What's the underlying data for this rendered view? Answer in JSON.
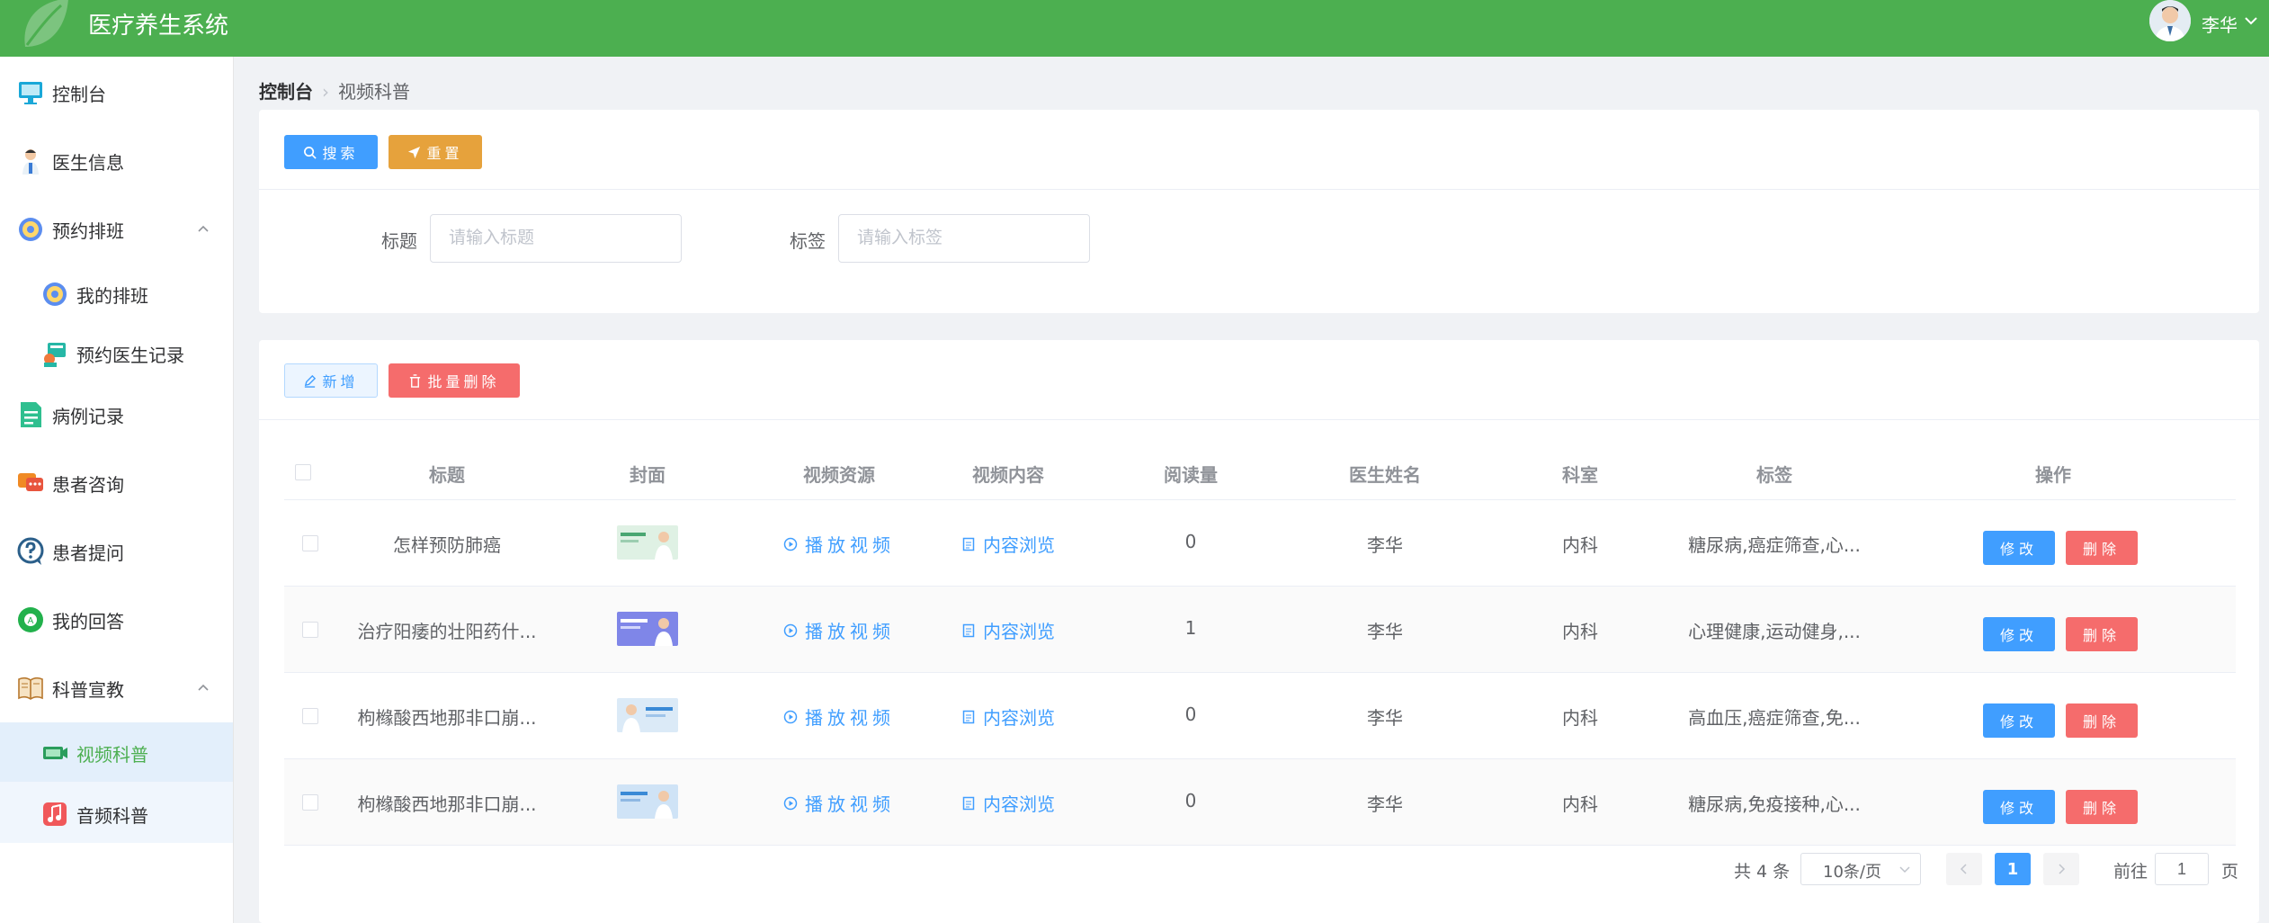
{
  "app": {
    "title": "医疗养生系统",
    "user_name": "李华"
  },
  "sidebar": {
    "items": [
      {
        "label": "控制台",
        "icon": "monitor-icon"
      },
      {
        "label": "医生信息",
        "icon": "doctor-icon"
      },
      {
        "label": "预约排班",
        "icon": "schedule-icon"
      },
      {
        "label": "我的排班",
        "icon": "my-schedule-icon"
      },
      {
        "label": "预约医生记录",
        "icon": "appointment-record-icon"
      },
      {
        "label": "病例记录",
        "icon": "medical-record-icon"
      },
      {
        "label": "患者咨询",
        "icon": "chat-icon"
      },
      {
        "label": "患者提问",
        "icon": "question-icon"
      },
      {
        "label": "我的回答",
        "icon": "answer-icon"
      },
      {
        "label": "科普宣教",
        "icon": "book-icon"
      },
      {
        "label": "视频科普",
        "icon": "video-icon"
      },
      {
        "label": "音频科普",
        "icon": "music-icon"
      }
    ]
  },
  "breadcrumb": {
    "root": "控制台",
    "current": "视频科普"
  },
  "search": {
    "search_label": "搜索",
    "reset_label": "重置",
    "title_label": "标题",
    "title_placeholder": "请输入标题",
    "tag_label": "标签",
    "tag_placeholder": "请输入标签"
  },
  "toolbar": {
    "add_label": "新增",
    "batch_delete_label": "批量删除"
  },
  "table": {
    "columns": [
      "标题",
      "封面",
      "视频资源",
      "视频内容",
      "阅读量",
      "医生姓名",
      "科室",
      "标签",
      "操作"
    ],
    "play_label": "播放视频",
    "content_label": "内容浏览",
    "edit_label": "修改",
    "delete_label": "删除",
    "rows": [
      {
        "title": "怎样预防肺癌",
        "views": "0",
        "doctor": "李华",
        "dept": "内科",
        "tags": "糖尿病,癌症筛查,心..."
      },
      {
        "title": "治疗阳痿的壮阳药什...",
        "views": "1",
        "doctor": "李华",
        "dept": "内科",
        "tags": "心理健康,运动健身,..."
      },
      {
        "title": "枸橼酸西地那非口崩...",
        "views": "0",
        "doctor": "李华",
        "dept": "内科",
        "tags": "高血压,癌症筛查,免..."
      },
      {
        "title": "枸橼酸西地那非口崩...",
        "views": "0",
        "doctor": "李华",
        "dept": "内科",
        "tags": "糖尿病,免疫接种,心..."
      }
    ]
  },
  "pagination": {
    "total": "共 4 条",
    "page_size": "10条/页",
    "current": "1",
    "goto_label": "前往",
    "goto_value": "1",
    "page_suffix": "页"
  },
  "colors": {
    "header": "#4caf50",
    "primary": "#409eff",
    "warning": "#e6a23c",
    "danger": "#f56c6c"
  }
}
